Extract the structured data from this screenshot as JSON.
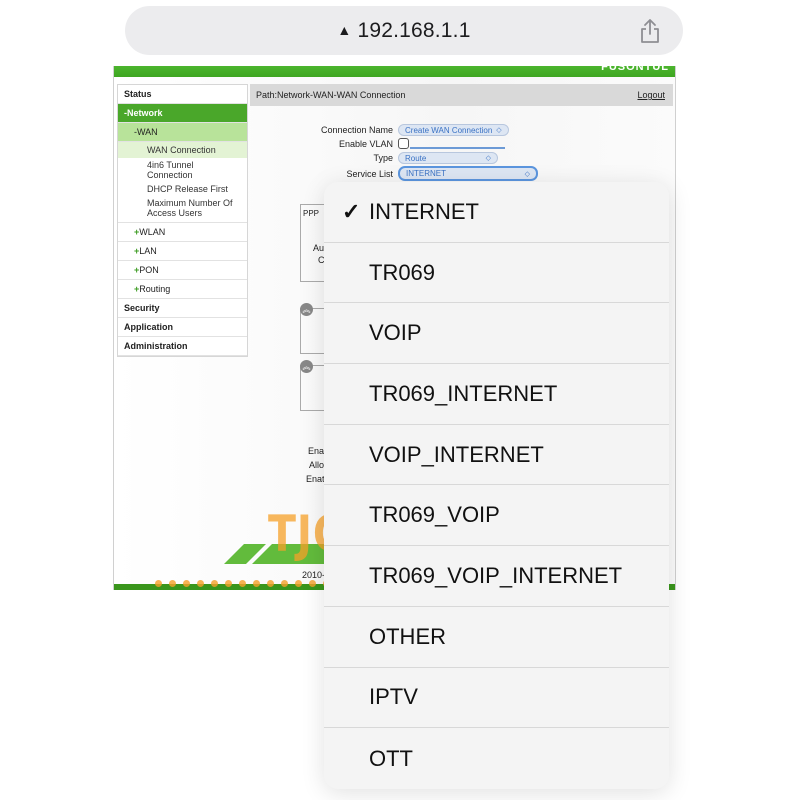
{
  "browser": {
    "address": "192.168.1.1",
    "warning_icon": "warning-triangle-icon",
    "share_icon": "share-icon"
  },
  "page": {
    "brand_fragment": "FUSONTUL",
    "path": "Path:Network-WAN-WAN Connection",
    "logout_label": "Logout",
    "sidebar": {
      "status": "Status",
      "network": "-Network",
      "wan": "-WAN",
      "wan_sub": [
        "WAN Connection",
        "4in6 Tunnel Connection",
        "DHCP Release First",
        "Maximum Number Of Access Users"
      ],
      "plus_items": [
        "WLAN",
        "LAN",
        "PON",
        "Routing"
      ],
      "plus_sign": "+",
      "security": "Security",
      "application": "Application",
      "administration": "Administration"
    },
    "form": {
      "connection_name_label": "Connection Name",
      "connection_name_value": "Create WAN Connection",
      "enable_vlan_label": "Enable VLAN",
      "enable_vlan_checked": false,
      "type_label": "Type",
      "type_value": "Route",
      "service_list_label": "Service List",
      "service_list_value": "INTERNET",
      "ppp_legend": "PPP",
      "partial_labels": [
        "Aut",
        "Co",
        "Ena",
        "Allo",
        "Enat"
      ]
    },
    "copyright_fragment": "2010-"
  },
  "picker": {
    "selected": "INTERNET",
    "options": [
      "INTERNET",
      "TR069",
      "VOIP",
      "TR069_INTERNET",
      "VOIP_INTERNET",
      "TR069_VOIP",
      "TR069_VOIP_INTERNET",
      "OTHER",
      "IPTV",
      "OTT"
    ]
  },
  "watermark": {
    "text": "TJCOMPUTER",
    "color": "#f5a028"
  },
  "colors": {
    "nav_green": "#4aa72a",
    "wan_light_green": "#b8e39a",
    "select_blue": "#3a72c4"
  }
}
